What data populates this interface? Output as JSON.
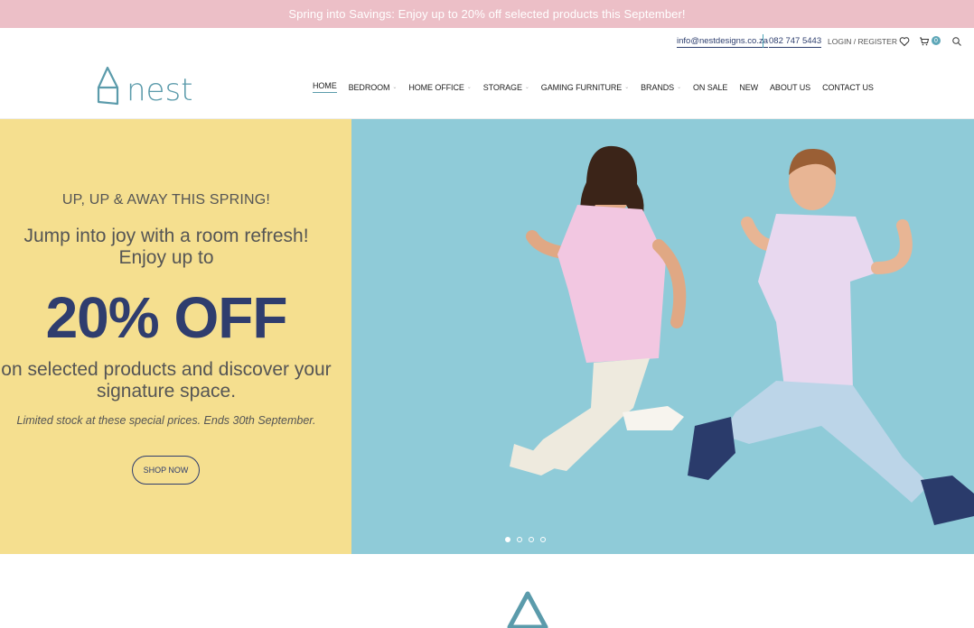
{
  "promo": {
    "text": "Spring into Savings: Enjoy up to 20% off selected products this September!"
  },
  "topbar": {
    "email": "info@nestdesigns.co.za",
    "phone": "082 747 5443",
    "login": "LOGIN / REGISTER",
    "cart_count": "0"
  },
  "header": {
    "logo_text": "nest",
    "nav": [
      {
        "label": "HOME",
        "active": true
      },
      {
        "label": "BEDROOM",
        "dropdown": true
      },
      {
        "label": "HOME OFFICE",
        "dropdown": true
      },
      {
        "label": "STORAGE",
        "dropdown": true
      },
      {
        "label": "GAMING FURNITURE",
        "dropdown": true
      },
      {
        "label": "BRANDS",
        "dropdown": true
      },
      {
        "label": "ON SALE"
      },
      {
        "label": "NEW"
      },
      {
        "label": "ABOUT US"
      },
      {
        "label": "CONTACT US"
      }
    ]
  },
  "hero": {
    "kicker": "UP, UP & AWAY THIS SPRING!",
    "line1": "Jump into joy with a room refresh! Enjoy up to",
    "big": "20% OFF",
    "line2": "on selected products and discover your signature space.",
    "note": "Limited stock at these special prices. Ends 30th September.",
    "cta": "SHOP NOW",
    "slides": 4,
    "active_slide": 1
  },
  "colors": {
    "promo_bg": "#ecbfc7",
    "accent": "#5b9bab",
    "navy": "#2f3d6e",
    "hero_left_bg": "#f5df8f",
    "hero_right_bg": "#8fcbd8"
  }
}
